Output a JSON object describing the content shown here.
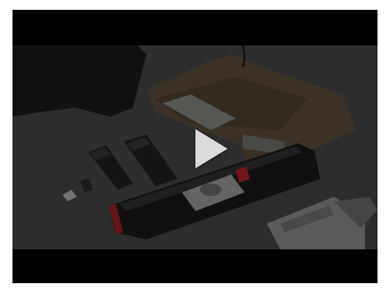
{
  "video_player": {
    "state": "paused",
    "play_icon": "play-icon",
    "colors": {
      "background": "#000000",
      "frame": "#363636",
      "accent_red": "#c0252b",
      "play_icon": "#ebebeb"
    }
  }
}
